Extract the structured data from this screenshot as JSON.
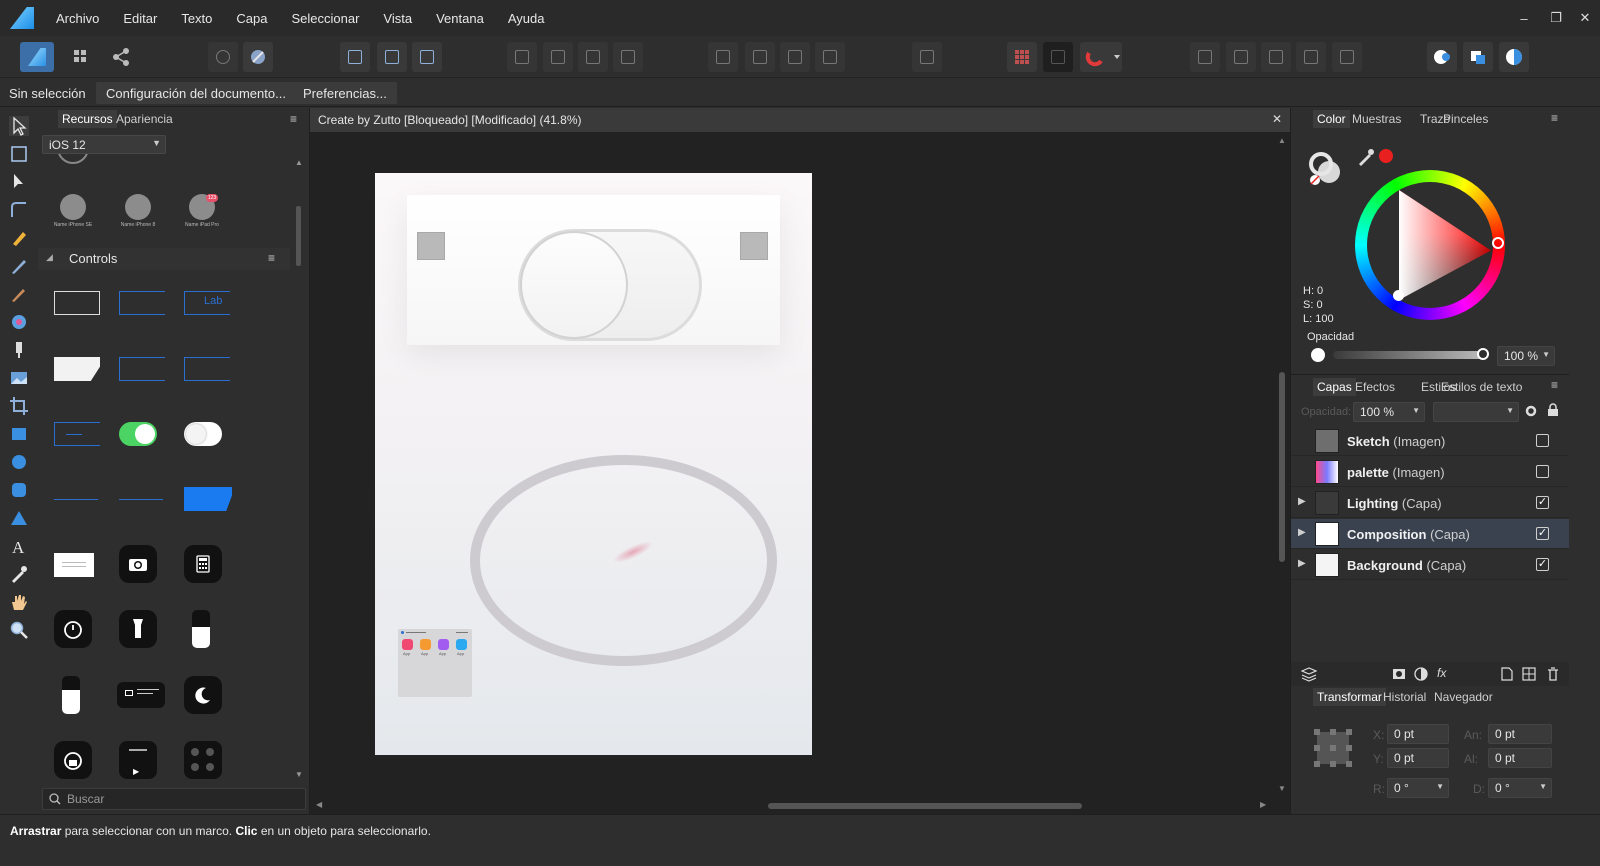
{
  "menubar": {
    "items": [
      "Archivo",
      "Editar",
      "Texto",
      "Capa",
      "Seleccionar",
      "Vista",
      "Ventana",
      "Ayuda"
    ]
  },
  "window_controls": {
    "minimize": "–",
    "restore": "❐",
    "close": "✕"
  },
  "contextbar": {
    "selection_label": "Sin selección",
    "document_setup_button": "Configuración del documento...",
    "preferences_button": "Preferencias..."
  },
  "left_panel": {
    "tabs": [
      "Recursos",
      "Apariencia"
    ],
    "active_tab": "Recursos",
    "library_select": "iOS 12",
    "device_labels": [
      "Name iPhone SE",
      "Name iPhone 8",
      "Name iPad Pro"
    ],
    "badge_count": "123",
    "section_title": "Controls",
    "label_control_text": "Lab",
    "search_placeholder": "Buscar"
  },
  "document": {
    "tab_title": "Create by Zutto [Bloqueado] [Modificado] (41.8%)",
    "close_label": "✕",
    "widget_labels": [
      "App",
      "App",
      "App",
      "App"
    ]
  },
  "color_panel": {
    "tabs": [
      "Color",
      "Muestras",
      "Trazo",
      "Pinceles"
    ],
    "active_tab": "Color",
    "h_label": "H: 0",
    "s_label": "S: 0",
    "l_label": "L: 100",
    "opacity_label": "Opacidad",
    "opacity_value": "100 %",
    "opacity_fraction": 1.0,
    "accent_color": "#e82020"
  },
  "layers_panel": {
    "tabs": [
      "Capas",
      "Efectos",
      "Estilos",
      "Estilos de texto"
    ],
    "active_tab": "Capas",
    "opacity_label": "Opacidad:",
    "opacity_value": "100 %",
    "layers": [
      {
        "name": "Sketch",
        "type": "(Imagen)",
        "checked": false,
        "expandable": false
      },
      {
        "name": "palette",
        "type": "(Imagen)",
        "checked": false,
        "expandable": false
      },
      {
        "name": "Lighting",
        "type": "(Capa)",
        "checked": true,
        "expandable": true
      },
      {
        "name": "Composition",
        "type": "(Capa)",
        "checked": true,
        "expandable": true
      },
      {
        "name": "Background",
        "type": "(Capa)",
        "checked": true,
        "expandable": true
      }
    ]
  },
  "transform_panel": {
    "tabs": [
      "Transformar",
      "Historial",
      "Navegador"
    ],
    "active_tab": "Transformar",
    "x_label": "X:",
    "x_value": "0 pt",
    "y_label": "Y:",
    "y_value": "0 pt",
    "w_label": "An:",
    "w_value": "0 pt",
    "h_label": "Al:",
    "h_value": "0 pt",
    "r_label": "R:",
    "r_value": "0 °",
    "s_label": "D:",
    "s_value": "0 °"
  },
  "statusbar": {
    "part1_bold": "Arrastrar",
    "part2": " para seleccionar con un marco. ",
    "part3_bold": "Clic",
    "part4": " en un objeto para seleccionarlo."
  }
}
